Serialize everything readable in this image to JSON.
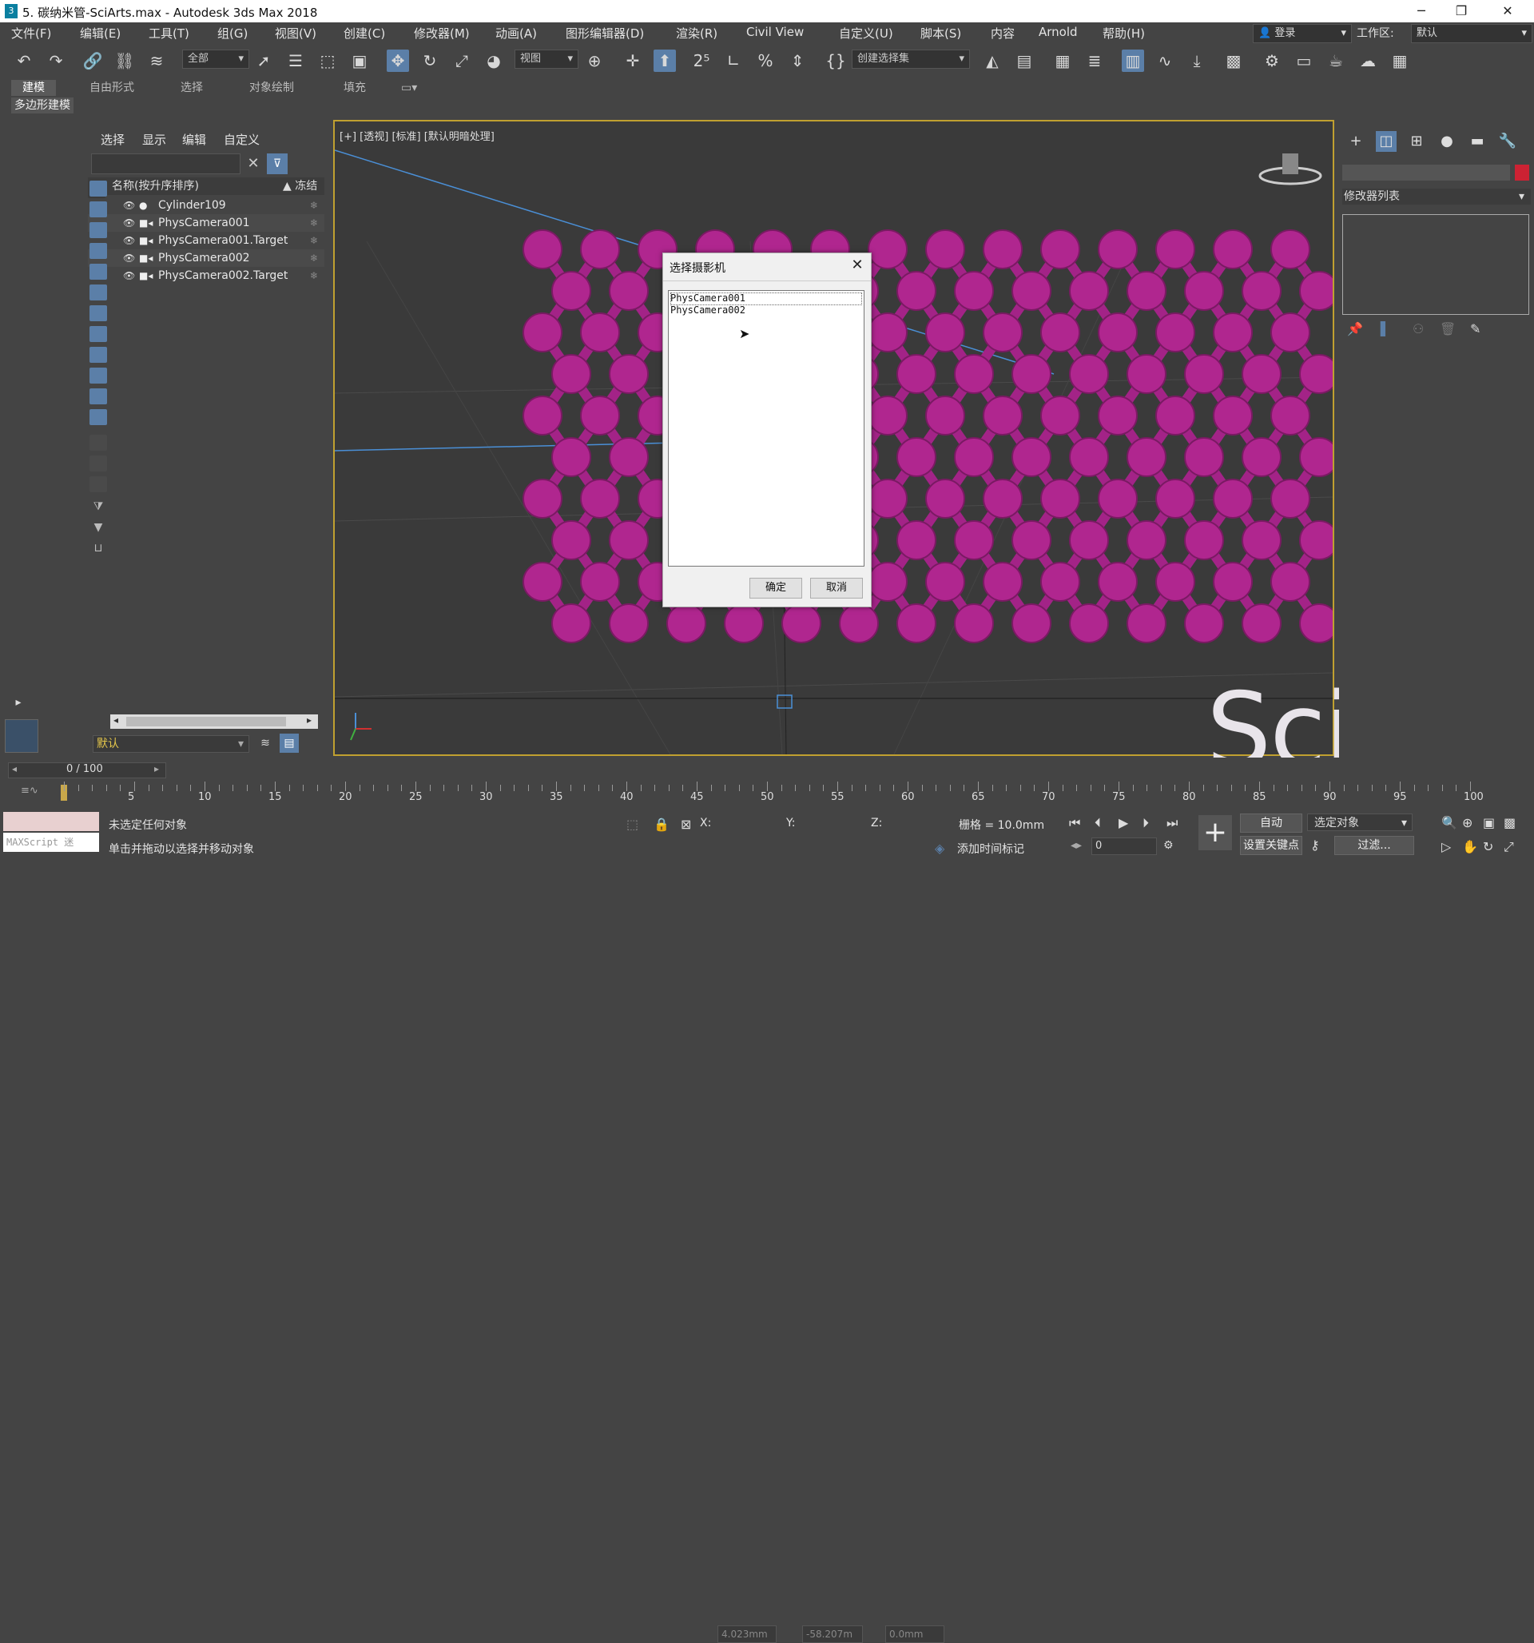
{
  "window": {
    "title": "5. 碳纳米管-SciArts.max - Autodesk 3ds Max 2018",
    "app_icon": "3",
    "controls": [
      "minimize-icon",
      "restore-icon",
      "close-icon"
    ]
  },
  "menubar": {
    "items": [
      "文件(F)",
      "编辑(E)",
      "工具(T)",
      "组(G)",
      "视图(V)",
      "创建(C)",
      "修改器(M)",
      "动画(A)",
      "图形编辑器(D)",
      "渲染(R)",
      "Civil View",
      "自定义(U)",
      "脚本(S)",
      "内容",
      "Arnold",
      "帮助(H)"
    ],
    "login": "登录",
    "workspace_label": "工作区:",
    "workspace_value": "默认"
  },
  "toolbar": {
    "selection_filter": "全部",
    "ref_coord": "视图",
    "selection_set": "创建选择集"
  },
  "ribbon": {
    "tabs": [
      "建模",
      "自由形式",
      "选择",
      "对象绘制",
      "填充"
    ],
    "active_tab": "建模",
    "sub_label": "多边形建模"
  },
  "explorer": {
    "menu": [
      "选择",
      "显示",
      "编辑",
      "自定义"
    ],
    "col_name": "名称(按升序排序)",
    "col_freeze": "▲ 冻结",
    "rows": [
      {
        "name": "Cylinder109",
        "type": "sphere-icon"
      },
      {
        "name": "PhysCamera001",
        "type": "camera-icon"
      },
      {
        "name": "PhysCamera001.Target",
        "type": "target-icon"
      },
      {
        "name": "PhysCamera002",
        "type": "camera-icon"
      },
      {
        "name": "PhysCamera002.Target",
        "type": "target-icon"
      }
    ],
    "layer_value": "默认"
  },
  "viewport": {
    "label": "[+] [透视] [标准] [默认明暗处理]",
    "molecule_color": "#b0268f"
  },
  "dialog": {
    "title": "选择摄影机",
    "items": [
      "PhysCamera001",
      "PhysCamera002"
    ],
    "ok": "确定",
    "cancel": "取消"
  },
  "command_panel": {
    "modifier_list": "修改器列表",
    "color_swatch": "#cc2233"
  },
  "timeline": {
    "frame": "0 / 100",
    "ticks": [
      "5",
      "10",
      "15",
      "20",
      "25",
      "30",
      "35",
      "40",
      "45",
      "50",
      "55",
      "60",
      "65",
      "70",
      "75",
      "80",
      "85",
      "90",
      "95",
      "100"
    ]
  },
  "status": {
    "maxscript": "MAXScript 迷",
    "line1": "未选定任何对象",
    "line2": "单击并拖动以选择并移动对象",
    "x_label": "X:",
    "x_value": "4.023mm",
    "y_label": "Y:",
    "y_value": "-58.207m",
    "z_label": "Z:",
    "z_value": "0.0mm",
    "grid": "栅格 = 10.0mm",
    "add_time_tag": "添加时间标记",
    "auto": "自动",
    "selected_object": "选定对象",
    "set_key": "设置关键点",
    "filter": "过滤...",
    "frame_spinner": "0"
  },
  "watermark": "SciArts"
}
